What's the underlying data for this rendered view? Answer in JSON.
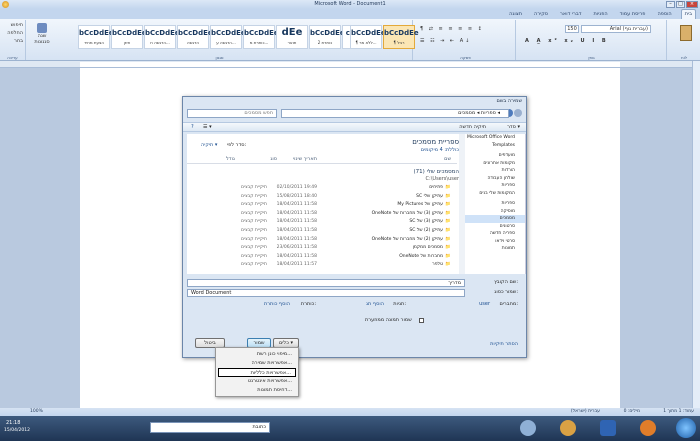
{
  "app": {
    "title": "Microsoft Word - Document1",
    "min": "–",
    "max": "□",
    "close": "×"
  },
  "tabs": [
    "בית",
    "הוספה",
    "פריסת עמוד",
    "הפניות",
    "דברי דואר",
    "סקירה",
    "תצוגה"
  ],
  "ribbon": {
    "font_name": "Arial (עברית גוף)",
    "font_size": "150",
    "styles": [
      {
        "sample": "bCcDdEe",
        "name": "¶ רגיל"
      },
      {
        "sample": "bCcDdEe",
        "name": "¶ ללא מר..."
      },
      {
        "sample": "cDdEe",
        "name": "כותרת 1"
      },
      {
        "sample": "bCcDdEe",
        "name": "כותרת 2"
      },
      {
        "sample": "dEe",
        "name": "תואר"
      },
      {
        "sample": "bCcDdEe",
        "name": "כותרת מ..."
      },
      {
        "sample": "bCcDdEe",
        "name": "הדגשה ע..."
      },
      {
        "sample": "bCcDdEe",
        "name": "הדגשה"
      },
      {
        "sample": "bCcDdEe",
        "name": "הדגשה ח..."
      },
      {
        "sample": "bCcDdEe",
        "name": "חזק"
      },
      {
        "sample": "bCcDdEe",
        "name": "הצעת מחיר"
      }
    ],
    "change_styles": "שנה סגנונות",
    "find": "חיפוש",
    "replace": "החלפה",
    "select": "בחר",
    "group_edit": "עריכה",
    "group_styles": "סגנון",
    "group_para": "פסקה",
    "group_font": "גופן",
    "group_clip": "לוח"
  },
  "dialog": {
    "title": "שמירה בשם",
    "path": "ספריות ◂ מסמכים ◂",
    "search_placeholder": "חפש מסמכים",
    "organize": "סדר ▾",
    "new_folder": "תיקיה חדשה",
    "lib_title": "ספריית מסמכים",
    "lib_sub": "כוללת: 4 מיקומים",
    "arrange_label": "סדר לפי:",
    "arrange_value": "תיקיה ▾",
    "cols": [
      "שם",
      "תאריך שינוי",
      "סוג",
      "גודל"
    ],
    "group_header": "המסמכים שלי (71)",
    "group_path": "C:\\Users\\user",
    "nav": [
      "Microsoft Office Word",
      "Templates",
      "מועדפים",
      "מקומות אחרונים",
      "הורדות",
      "שולחן העבודה",
      "ספריות",
      "המקומות שלי בנים",
      "ספריות",
      "מוסיקה",
      "מסמכים",
      "סרטונים",
      "ספריה חדשה",
      "סרטי וידאו",
      "תמונות"
    ],
    "nav_selected": 10,
    "files": [
      {
        "name": "פתיחים",
        "date": "02/10/2011 19:49",
        "type": "תיקיית קבצים"
      },
      {
        "name": "SC עתיקן שלי",
        "date": "15/08/2011 18:40",
        "type": "תיקיית קבצים"
      },
      {
        "name": "My Pictures עתיקן של",
        "date": "18/04/2011 11:58",
        "type": "תיקיית קבצים"
      },
      {
        "name": "OneNote עתיקן (3) של מחברות של",
        "date": "18/04/2011 11:58",
        "type": "תיקיית קבצים"
      },
      {
        "name": "SC עתיקן (3) של",
        "date": "18/04/2011 11:58",
        "type": "תיקיית קבצים"
      },
      {
        "name": "SC עתיקן (2) של",
        "date": "18/04/2011 11:58",
        "type": "תיקיית קבצים"
      },
      {
        "name": "OneNote עתיקן (2) של מחברות של",
        "date": "18/04/2011 11:58",
        "type": "תיקיית קבצים"
      },
      {
        "name": "מסמכים ממקמן",
        "date": "23/06/2011 11:58",
        "type": "תיקיית קבצים"
      },
      {
        "name": "OneNote מחברות של",
        "date": "18/04/2011 11:58",
        "type": "תיקיית קבצים"
      },
      {
        "name": "טלפר",
        "date": "18/04/2011 11:57",
        "type": "תיקיית קבצים"
      }
    ],
    "filename_label": "שם הקובץ:",
    "filename_value": "מדריך",
    "type_label": "שמור כסוג:",
    "type_value": "Word Document",
    "authors_label": "מחברים:",
    "authors_value": "user",
    "tags_label": "תגיות:",
    "tags_value": "הוסף תג",
    "title_label": "כותרת:",
    "title_value": "הוסף כותרת",
    "thumb_label": "שמור תמונה ממוזערת",
    "hide_folders": "הסתר תיקיות",
    "tools": "כלים ▾",
    "save": "שמור",
    "cancel": "ביטול"
  },
  "tools_menu": {
    "items": [
      "מיפוי כונן רשת...",
      "אפשרויות שמירה...",
      "אפשרויות כלליות...",
      "אפשרויות אינטרנט...",
      "דחיסת תמונות..."
    ],
    "highlight": 2
  },
  "status": {
    "left": "עמוד: 1 מתוך 1",
    "words": "מילים: 0",
    "lang": "עברית (ישראל)",
    "zoom": "100%"
  },
  "taskbar": {
    "time": "21:18",
    "date": "15/04/2012",
    "address": "כתובת"
  }
}
